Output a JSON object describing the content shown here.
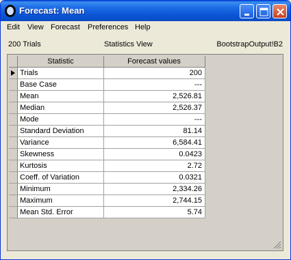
{
  "window": {
    "title": "Forecast: Mean",
    "minimize_icon": "minimize-icon",
    "maximize_icon": "maximize-icon",
    "close_icon": "close-icon"
  },
  "menu": [
    "Edit",
    "View",
    "Forecast",
    "Preferences",
    "Help"
  ],
  "info": {
    "trials": "200 Trials",
    "view": "Statistics View",
    "source": "BootstrapOutput!B2"
  },
  "table": {
    "headers": [
      "Statistic",
      "Forecast values"
    ],
    "rows": [
      {
        "stat": "Trials",
        "value": "200"
      },
      {
        "stat": "Base Case",
        "value": "---"
      },
      {
        "stat": "Mean",
        "value": "2,526.81"
      },
      {
        "stat": "Median",
        "value": "2,526.37"
      },
      {
        "stat": "Mode",
        "value": "---"
      },
      {
        "stat": "Standard Deviation",
        "value": "81.14"
      },
      {
        "stat": "Variance",
        "value": "6,584.41"
      },
      {
        "stat": "Skewness",
        "value": "0.0423"
      },
      {
        "stat": "Kurtosis",
        "value": "2.72"
      },
      {
        "stat": "Coeff. of Variation",
        "value": "0.0321"
      },
      {
        "stat": "Minimum",
        "value": "2,334.26"
      },
      {
        "stat": "Maximum",
        "value": "2,744.15"
      },
      {
        "stat": "Mean Std. Error",
        "value": "5.74"
      }
    ]
  }
}
